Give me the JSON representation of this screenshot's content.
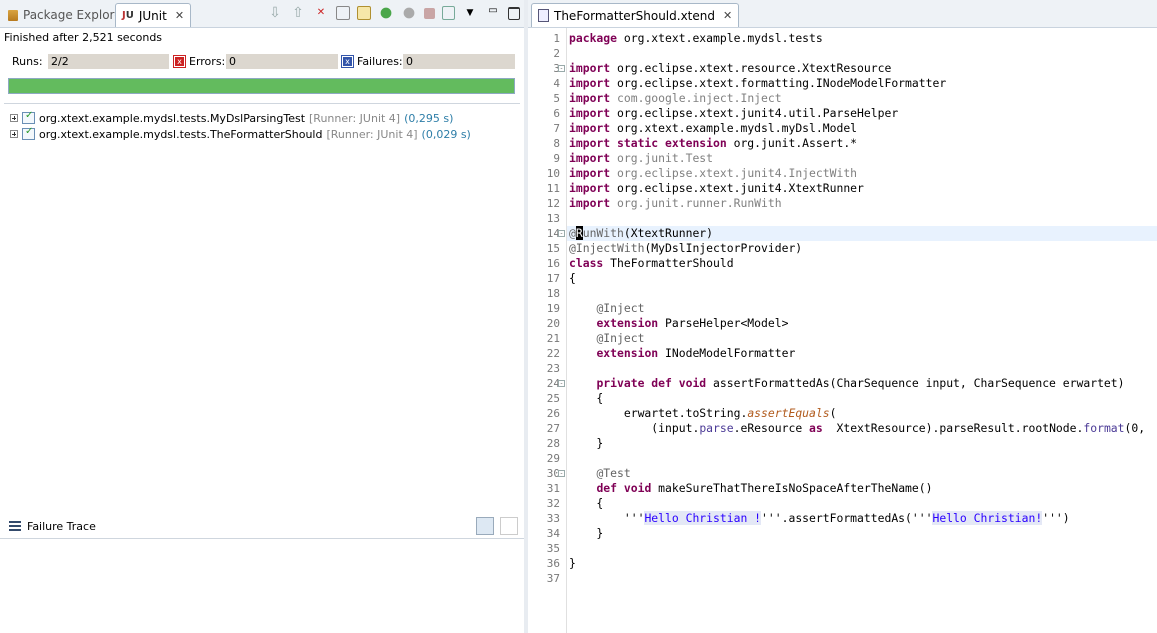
{
  "left_panel": {
    "tabs": [
      {
        "label": "Package Explorer",
        "active": false,
        "icon": "package-explorer-icon"
      },
      {
        "label": "JUnit",
        "active": true,
        "icon": "junit-icon"
      }
    ],
    "toolbar_icons": [
      "next-failure-icon",
      "previous-failure-icon",
      "show-failures-only-icon",
      "scroll-lock-icon",
      "history-icon",
      "rerun-test-icon",
      "rerun-failed-first-icon",
      "stop-icon",
      "test-run-history-icon",
      "view-menu-icon",
      "minimize-icon",
      "maximize-icon"
    ],
    "status_text": "Finished after 2,521 seconds",
    "counts": {
      "runs_label": "Runs:",
      "runs_value": "2/2",
      "errors_label": "Errors:",
      "errors_value": "0",
      "failures_label": "Failures:",
      "failures_value": "0"
    },
    "progress_fraction": 1.0,
    "progress_color": "#63bb5e",
    "tests": [
      {
        "name": "org.xtext.example.mydsl.tests.MyDslParsingTest",
        "runner": "[Runner: JUnit 4]",
        "time": "(0,295 s)"
      },
      {
        "name": "org.xtext.example.mydsl.tests.TheFormatterShould",
        "runner": "[Runner: JUnit 4]",
        "time": "(0,029 s)"
      }
    ],
    "failure_trace": {
      "label": "Failure Trace"
    }
  },
  "editor": {
    "tab_label": "TheFormatterShould.xtend",
    "lines": [
      {
        "n": "1",
        "fold": "",
        "segs": [
          [
            "kw",
            "package"
          ],
          [
            "",
            "org.xtext.example.mydsl.tests"
          ]
        ]
      },
      {
        "n": "2",
        "fold": "",
        "segs": []
      },
      {
        "n": "3",
        "fold": "-",
        "segs": [
          [
            "kw",
            "import"
          ],
          [
            "",
            "org.eclipse.xtext.resource.XtextResource"
          ]
        ]
      },
      {
        "n": "4",
        "fold": "",
        "segs": [
          [
            "kw",
            "import"
          ],
          [
            "",
            "org.eclipse.xtext.formatting.INodeModelFormatter"
          ]
        ]
      },
      {
        "n": "5",
        "fold": "",
        "segs": [
          [
            "kw",
            "import"
          ],
          [
            "gray",
            "com.google.inject.Inject"
          ]
        ]
      },
      {
        "n": "6",
        "fold": "",
        "segs": [
          [
            "kw",
            "import"
          ],
          [
            "",
            "org.eclipse.xtext.junit4.util.ParseHelper"
          ]
        ]
      },
      {
        "n": "7",
        "fold": "",
        "segs": [
          [
            "kw",
            "import"
          ],
          [
            "",
            "org.xtext.example.mydsl.myDsl.Model"
          ]
        ]
      },
      {
        "n": "8",
        "fold": "",
        "segs": [
          [
            "kw",
            "import static extension"
          ],
          [
            "",
            "org.junit.Assert.*"
          ]
        ]
      },
      {
        "n": "9",
        "fold": "",
        "segs": [
          [
            "kw",
            "import"
          ],
          [
            "gray",
            "org.junit.Test"
          ]
        ]
      },
      {
        "n": "10",
        "fold": "",
        "segs": [
          [
            "kw",
            "import"
          ],
          [
            "gray",
            "org.eclipse.xtext.junit4.InjectWith"
          ]
        ]
      },
      {
        "n": "11",
        "fold": "",
        "segs": [
          [
            "kw",
            "import"
          ],
          [
            "",
            "org.eclipse.xtext.junit4.XtextRunner"
          ]
        ]
      },
      {
        "n": "12",
        "fold": "",
        "segs": [
          [
            "kw",
            "import"
          ],
          [
            "gray",
            "org.junit.runner.RunWith"
          ]
        ]
      },
      {
        "n": "13",
        "fold": "",
        "segs": []
      },
      {
        "n": "14",
        "fold": "-",
        "hl": true,
        "segs": [
          [
            "ann",
            "@"
          ],
          [
            "cursor",
            "R"
          ],
          [
            "ann",
            "unWith"
          ],
          [
            "",
            "(XtextRunner)"
          ]
        ]
      },
      {
        "n": "15",
        "fold": "",
        "segs": [
          [
            "ann",
            "@InjectWith"
          ],
          [
            "",
            "(MyDslInjectorProvider)"
          ]
        ]
      },
      {
        "n": "16",
        "fold": "",
        "segs": [
          [
            "kw",
            "class"
          ],
          [
            "",
            "TheFormatterShould"
          ]
        ]
      },
      {
        "n": "17",
        "fold": "",
        "segs": [
          [
            "",
            "{"
          ]
        ]
      },
      {
        "n": "18",
        "fold": "",
        "segs": []
      },
      {
        "n": "19",
        "fold": "",
        "segs": [
          [
            "",
            "    "
          ],
          [
            "ann",
            "@Inject"
          ]
        ]
      },
      {
        "n": "20",
        "fold": "",
        "segs": [
          [
            "",
            "    "
          ],
          [
            "kw",
            "extension"
          ],
          [
            "",
            "ParseHelper<Model>"
          ]
        ]
      },
      {
        "n": "21",
        "fold": "",
        "segs": [
          [
            "",
            "    "
          ],
          [
            "ann",
            "@Inject"
          ]
        ]
      },
      {
        "n": "22",
        "fold": "",
        "segs": [
          [
            "",
            "    "
          ],
          [
            "kw",
            "extension"
          ],
          [
            "",
            "INodeModelFormatter"
          ]
        ]
      },
      {
        "n": "23",
        "fold": "",
        "segs": []
      },
      {
        "n": "24",
        "fold": "-",
        "segs": [
          [
            "",
            "    "
          ],
          [
            "kw",
            "private def void"
          ],
          [
            "",
            "assertFormattedAs(CharSequence input, CharSequence erwartet)"
          ]
        ]
      },
      {
        "n": "25",
        "fold": "",
        "segs": [
          [
            "",
            "    {"
          ]
        ]
      },
      {
        "n": "26",
        "fold": "",
        "segs": [
          [
            "",
            "        erwartet.toString."
          ],
          [
            "it",
            "assertEquals"
          ],
          [
            "",
            "("
          ]
        ]
      },
      {
        "n": "27",
        "fold": "",
        "segs": [
          [
            "",
            "            (input."
          ],
          [
            "ext",
            "parse"
          ],
          [
            "",
            ".eResource "
          ],
          [
            "kw",
            "as"
          ],
          [
            "",
            "XtextResource).parseResult.rootNode."
          ],
          [
            "ext",
            "format"
          ],
          [
            "",
            "(0,"
          ]
        ]
      },
      {
        "n": "28",
        "fold": "",
        "segs": [
          [
            "",
            "    }"
          ]
        ]
      },
      {
        "n": "29",
        "fold": "",
        "segs": []
      },
      {
        "n": "30",
        "fold": "-",
        "segs": [
          [
            "",
            "    "
          ],
          [
            "ann",
            "@Test"
          ]
        ]
      },
      {
        "n": "31",
        "fold": "",
        "segs": [
          [
            "",
            "    "
          ],
          [
            "kw",
            "def void"
          ],
          [
            "",
            "makeSureThatThereIsNoSpaceAfterTheName()"
          ]
        ]
      },
      {
        "n": "32",
        "fold": "",
        "segs": [
          [
            "",
            "    {"
          ]
        ]
      },
      {
        "n": "33",
        "fold": "",
        "segs": [
          [
            "",
            "        '''"
          ],
          [
            "str",
            "Hello Christian !"
          ],
          [
            "",
            "'''.assertFormattedAs('''"
          ],
          [
            "str",
            "Hello Christian!"
          ],
          [
            "",
            "''')"
          ]
        ]
      },
      {
        "n": "34",
        "fold": "",
        "segs": [
          [
            "",
            "    }"
          ]
        ]
      },
      {
        "n": "35",
        "fold": "",
        "segs": []
      },
      {
        "n": "36",
        "fold": "",
        "segs": [
          [
            "",
            "}"
          ]
        ]
      },
      {
        "n": "37",
        "fold": "",
        "segs": []
      }
    ]
  }
}
